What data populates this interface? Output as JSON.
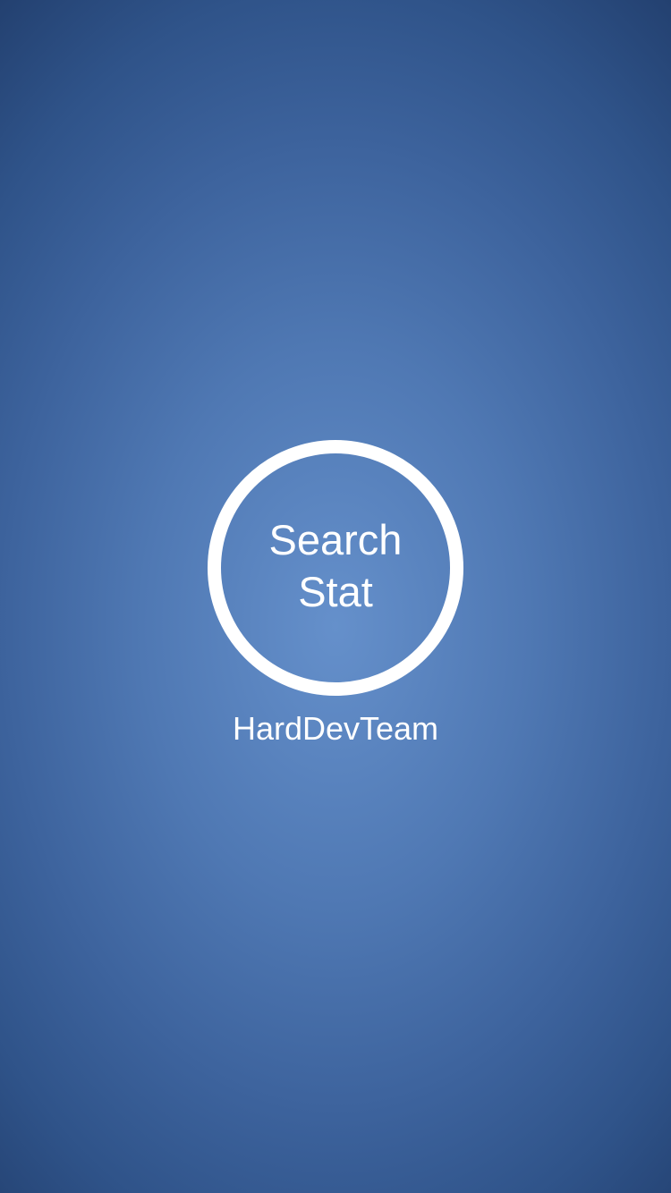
{
  "splash": {
    "logo": {
      "line1": "Search",
      "line2": "Stat"
    },
    "company_name": "HardDevTeam"
  },
  "colors": {
    "background_center": "#6590cb",
    "background_edge": "#223f6e",
    "foreground": "#ffffff"
  }
}
